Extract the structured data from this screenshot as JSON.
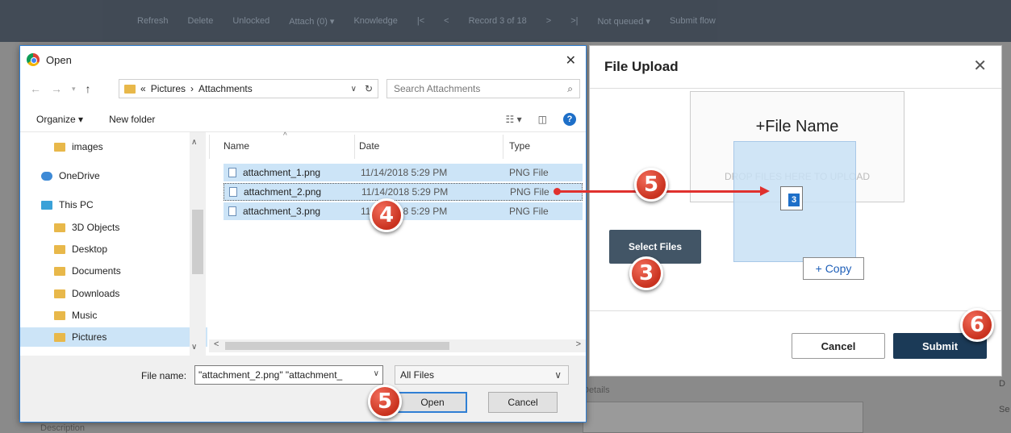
{
  "background": {
    "toolbar": [
      "Refresh",
      "Delete",
      "Unlocked",
      "Attach (0) ▾",
      "Knowledge",
      "|<",
      "<",
      "Record 3 of 18",
      ">",
      ">|",
      "Not queued ▾",
      "Submit flow"
    ],
    "details_label": "Details",
    "description_label": "Description",
    "right_letters": [
      "D",
      "Se"
    ]
  },
  "open_dialog": {
    "title": "Open",
    "address": [
      "Pictures",
      "Attachments"
    ],
    "address_prefix": "«",
    "search_placeholder": "Search Attachments",
    "organize": "Organize ▾",
    "new_folder": "New folder",
    "tree": [
      {
        "label": "images",
        "icon": "folder"
      },
      {
        "label": "OneDrive",
        "icon": "onedrive"
      },
      {
        "label": "This PC",
        "icon": "pc"
      },
      {
        "label": "3D Objects",
        "icon": "folder"
      },
      {
        "label": "Desktop",
        "icon": "folder"
      },
      {
        "label": "Documents",
        "icon": "folder"
      },
      {
        "label": "Downloads",
        "icon": "folder"
      },
      {
        "label": "Music",
        "icon": "folder"
      },
      {
        "label": "Pictures",
        "icon": "folder"
      }
    ],
    "columns": {
      "name": "Name",
      "date": "Date",
      "type": "Type"
    },
    "files": [
      {
        "name": "attachment_1.png",
        "date": "11/14/2018 5:29 PM",
        "type": "PNG File"
      },
      {
        "name": "attachment_2.png",
        "date": "11/14/2018 5:29 PM",
        "type": "PNG File"
      },
      {
        "name": "attachment_3.png",
        "date": "11/14/2018 5:29 PM",
        "type": "PNG File"
      }
    ],
    "file_name_label": "File name:",
    "file_name_value": "\"attachment_2.png\" \"attachment_",
    "filter": "All Files",
    "open_label": "Open",
    "cancel_label": "Cancel"
  },
  "upload_dialog": {
    "title": "File Upload",
    "drop_title": "+File Name",
    "drop_text": "DROP FILES HERE TO UPLOAD",
    "drag_count": "3",
    "copy_tip": "+ Copy",
    "select_files": "Select Files",
    "cancel": "Cancel",
    "submit": "Submit"
  },
  "steps": [
    "4",
    "5",
    "3",
    "5",
    "6"
  ]
}
